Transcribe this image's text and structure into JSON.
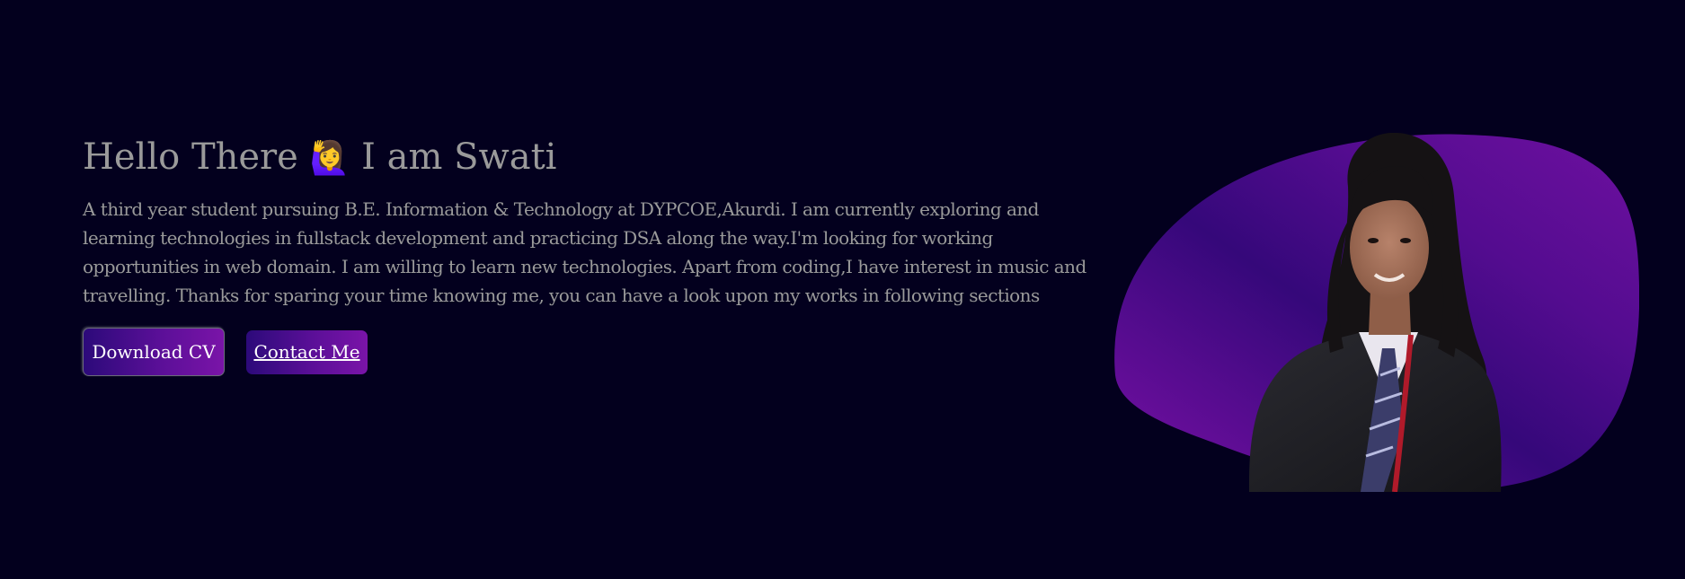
{
  "hero": {
    "greeting": "Hello There",
    "wave_emoji": "🙋‍♀️",
    "intro_name": "I am Swati",
    "about": "A third year student pursuing B.E. Information & Technology at DYPCOE,Akurdi. I am currently exploring and learning technologies in fullstack development and practicing DSA along the way.I'm looking for working opportunities in web domain. I am willing to learn new technologies. Apart from coding,I have interest in music and travelling. Thanks for sparing your time knowing me, you can have a look upon my works in following sections",
    "download_cv_label": "Download CV",
    "contact_label": "Contact Me"
  },
  "colors": {
    "background": "#03001e",
    "text": "#9a9a9a",
    "accent_start": "#2c0a7a",
    "accent_end": "#7a14a8"
  },
  "portrait": {
    "icon": "profile-photo"
  }
}
